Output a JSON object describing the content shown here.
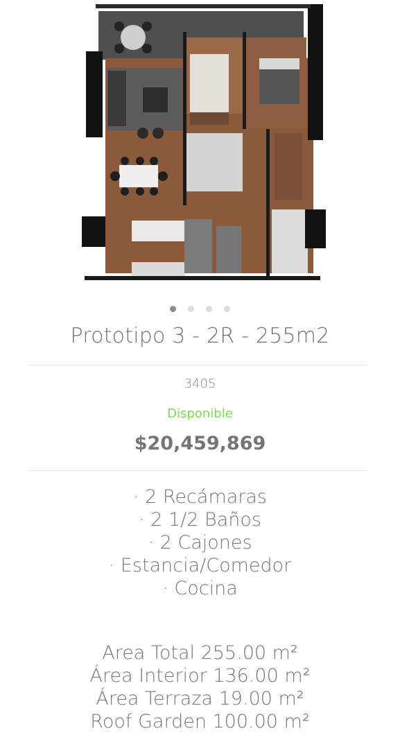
{
  "listing": {
    "title": "Prototipo 3 - 2R - 255m2",
    "unit": "3405",
    "status": "Disponible",
    "price": "$20,459,869"
  },
  "carousel": {
    "dots": 4,
    "active": 0
  },
  "features": [
    "· 2 Recámaras",
    "· 2 1/2 Baños",
    "· 2 Cajones",
    "· Estancia/Comedor",
    "· Cocina"
  ],
  "areas": [
    "Area Total 255.00 m²",
    "Área Interior 136.00 m²",
    "Área Terraza 19.00 m²",
    "Roof Garden 100.00 m²"
  ],
  "colors": {
    "status": "#7ed957",
    "wood": "#8a5a3b",
    "wall": "#111111",
    "terrace": "#4d4d4d"
  }
}
